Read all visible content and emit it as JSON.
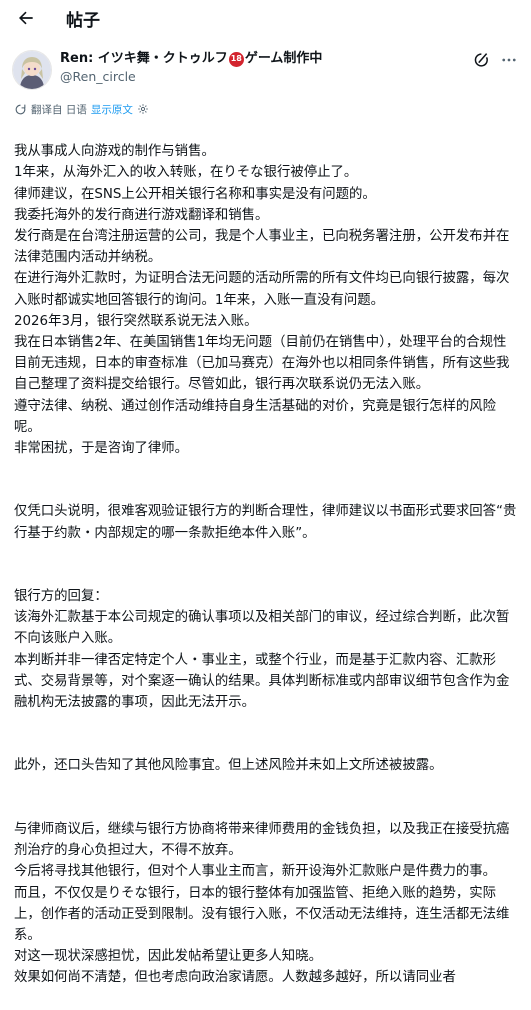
{
  "header": {
    "title": "帖子"
  },
  "author": {
    "name_prefix": "Ren: イツキ舞・クトゥルフ",
    "age_badge": "18",
    "name_suffix": "ゲーム制作中",
    "handle": "@Ren_circle"
  },
  "translation": {
    "translated_from": "翻译自 日语",
    "show_original": "显示原文"
  },
  "post": {
    "paragraphs": [
      "我从事成人向游戏的制作与销售。\n1年来，从海外汇入的收入转账，在りそな银行被停止了。\n律师建议，在SNS上公开相关银行名称和事实是没有问题的。\n我委托海外的发行商进行游戏翻译和销售。\n发行商是在台湾注册运营的公司，我是个人事业主，已向税务署注册，公开发布并在法律范围内活动并纳税。\n在进行海外汇款时，为证明合法无问题的活动所需的所有文件均已向银行披露，每次入账时都诚实地回答银行的询问。1年来，入账一直没有问题。\n2026年3月，银行突然联系说无法入账。\n我在日本销售2年、在美国销售1年均无问题（目前仍在销售中），处理平台的合规性目前无违规，日本的审查标准（已加马赛克）在海外也以相同条件销售，所有这些我自己整理了资料提交给银行。尽管如此，银行再次联系说仍无法入账。\n遵守法律、纳税、通过创作活动维持自身生活基础的对价，究竟是银行怎样的风险呢。\n非常困扰，于是咨询了律师。",
      "仅凭口头说明，很难客观验证银行方的判断合理性，律师建议以书面形式要求回答“贵行基于约款・内部规定的哪一条款拒绝本件入账”。",
      "银行方的回复：\n该海外汇款基于本公司规定的确认事项以及相关部门的审议，经过综合判断，此次暂不向该账户入账。\n本判断并非一律否定特定个人・事业主，或整个行业，而是基于汇款内容、汇款形式、交易背景等，对个案逐一确认的结果。具体判断标准或内部审议细节包含作为金融机构无法披露的事项，因此无法开示。",
      "此外，还口头告知了其他风险事宜。但上述风险并未如上文所述被披露。",
      "与律师商议后，继续与银行方协商将带来律师费用的金钱负担，以及我正在接受抗癌剂治疗的身心负担过大，不得不放弃。\n今后将寻找其他银行，但对个人事业主而言，新开设海外汇款账户是件费力的事。\n而且，不仅仅是りそな银行，日本的银行整体有加强监管、拒绝入账的趋势，实际上，创作者的活动正受到限制。没有银行入账，不仅活动无法维持，连生活都无法维系。\n对这一现状深感担忧，因此发帖希望让更多人知晓。\n效果如何尚不清楚，但也考虑向政治家请愿。人数越多越好，所以请同业者"
    ]
  }
}
